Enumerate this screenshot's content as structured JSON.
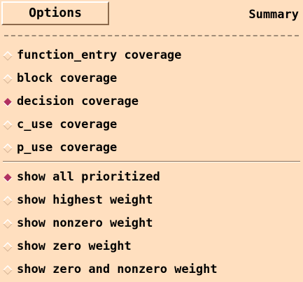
{
  "menubar": {
    "options_label": "Options",
    "summary_label": "Summary"
  },
  "coverage_group": {
    "items": [
      {
        "label": "function_entry coverage",
        "selected": false
      },
      {
        "label": "block coverage",
        "selected": false
      },
      {
        "label": "decision coverage",
        "selected": true
      },
      {
        "label": "c_use coverage",
        "selected": false
      },
      {
        "label": "p_use coverage",
        "selected": false
      }
    ]
  },
  "weight_group": {
    "items": [
      {
        "label": "show all prioritized",
        "selected": true
      },
      {
        "label": "show highest weight",
        "selected": false
      },
      {
        "label": "show nonzero weight",
        "selected": false
      },
      {
        "label": "show zero weight",
        "selected": false
      },
      {
        "label": "show zero and nonzero weight",
        "selected": false
      }
    ]
  },
  "colors": {
    "background": "#ffdfbf",
    "selected_indicator": "#b03060",
    "bevel_light": "#ffffff",
    "bevel_dark": "#8c6a4c"
  },
  "icons": {
    "radio": "diamond-radio-icon",
    "tearoff": "tearoff-line"
  }
}
